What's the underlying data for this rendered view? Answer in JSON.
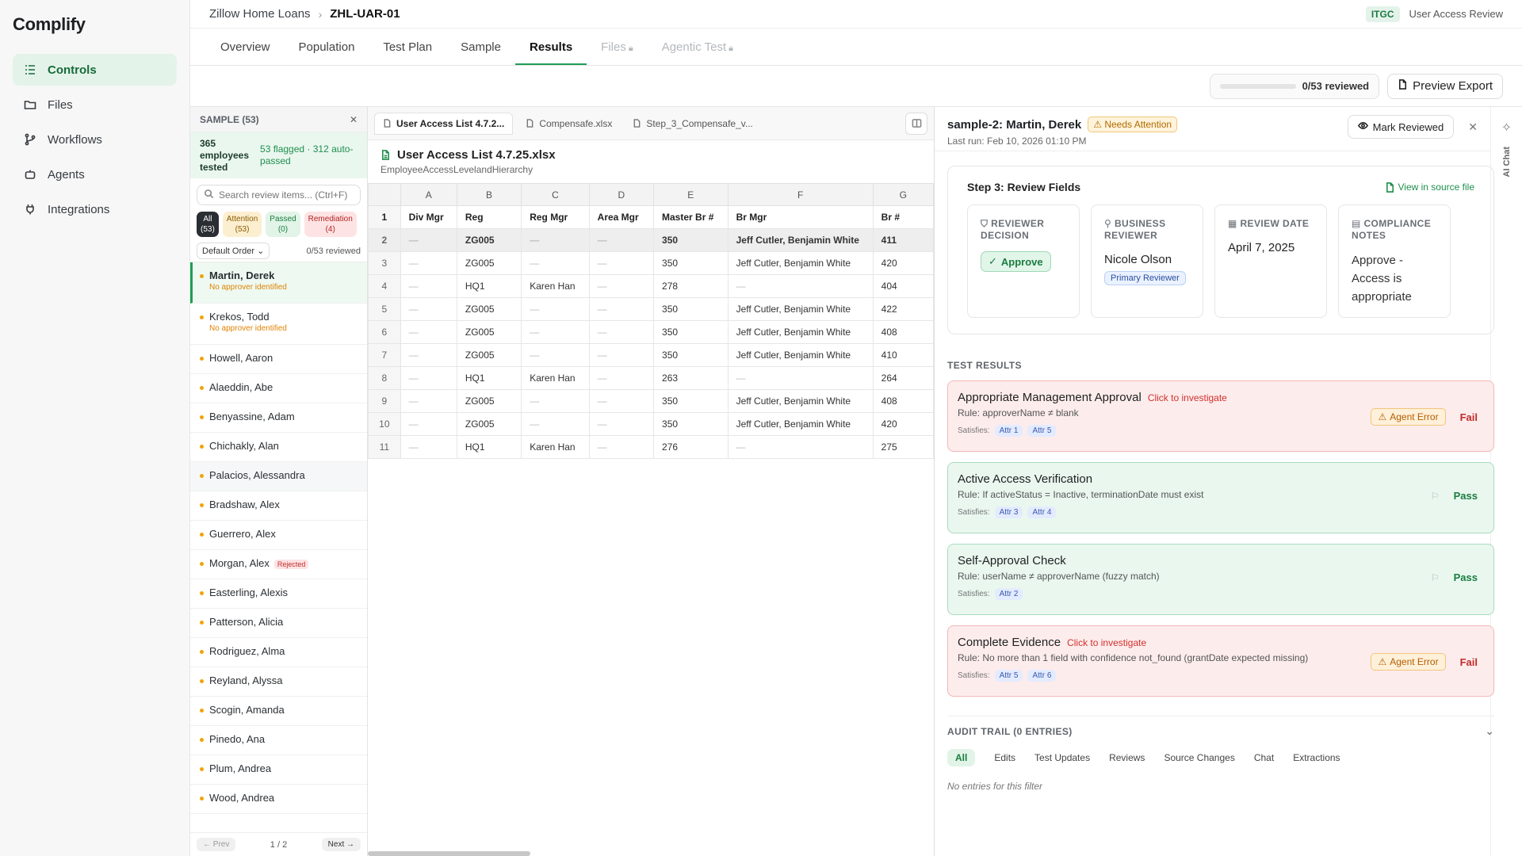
{
  "app": {
    "logo": "Complify"
  },
  "sidebar": {
    "items": [
      {
        "label": "Controls",
        "icon": "list-icon"
      },
      {
        "label": "Files",
        "icon": "folder-icon"
      },
      {
        "label": "Workflows",
        "icon": "branch-icon"
      },
      {
        "label": "Agents",
        "icon": "robot-icon"
      },
      {
        "label": "Integrations",
        "icon": "plug-icon"
      }
    ]
  },
  "breadcrumb": {
    "parent": "Zillow Home Loans",
    "current": "ZHL-UAR-01"
  },
  "header": {
    "badge": "ITGC",
    "title": "User Access Review"
  },
  "tabs": [
    {
      "label": "Overview"
    },
    {
      "label": "Population"
    },
    {
      "label": "Test Plan"
    },
    {
      "label": "Sample"
    },
    {
      "label": "Results"
    },
    {
      "label": "Files"
    },
    {
      "label": "Agentic Test"
    }
  ],
  "actions": {
    "reviewed": "0/53 reviewed",
    "progress": 0,
    "export": "Preview Export"
  },
  "samples": {
    "title": "SAMPLE (53)",
    "summary_left": "365 employees tested",
    "summary_right": "53 flagged · 312 auto-passed",
    "search_placeholder": "Search review items... (Ctrl+F)",
    "filters": [
      {
        "line1": "All",
        "line2": "(53)"
      },
      {
        "line1": "Attention",
        "line2": "(53)"
      },
      {
        "line1": "Passed",
        "line2": "(0)"
      },
      {
        "line1": "Remediation",
        "line2": "(4)"
      }
    ],
    "order": "Default Order",
    "reviewed": "0/53 reviewed",
    "items": [
      {
        "name": "Martin, Derek",
        "sub": "No approver identified",
        "tag": ""
      },
      {
        "name": "Krekos, Todd",
        "sub": "No approver identified",
        "tag": ""
      },
      {
        "name": "Howell, Aaron",
        "sub": "",
        "tag": ""
      },
      {
        "name": "Alaeddin, Abe",
        "sub": "",
        "tag": ""
      },
      {
        "name": "Benyassine, Adam",
        "sub": "",
        "tag": ""
      },
      {
        "name": "Chichakly, Alan",
        "sub": "",
        "tag": ""
      },
      {
        "name": "Palacios, Alessandra",
        "sub": "",
        "tag": ""
      },
      {
        "name": "Bradshaw, Alex",
        "sub": "",
        "tag": ""
      },
      {
        "name": "Guerrero, Alex",
        "sub": "",
        "tag": ""
      },
      {
        "name": "Morgan, Alex",
        "sub": "",
        "tag": "Rejected"
      },
      {
        "name": "Easterling, Alexis",
        "sub": "",
        "tag": ""
      },
      {
        "name": "Patterson, Alicia",
        "sub": "",
        "tag": ""
      },
      {
        "name": "Rodriguez, Alma",
        "sub": "",
        "tag": ""
      },
      {
        "name": "Reyland, Alyssa",
        "sub": "",
        "tag": ""
      },
      {
        "name": "Scogin, Amanda",
        "sub": "",
        "tag": ""
      },
      {
        "name": "Pinedo, Ana",
        "sub": "",
        "tag": ""
      },
      {
        "name": "Plum, Andrea",
        "sub": "",
        "tag": ""
      },
      {
        "name": "Wood, Andrea",
        "sub": "",
        "tag": ""
      }
    ],
    "prev": "← Prev",
    "page": "1 / 2",
    "next": "Next →"
  },
  "sheet": {
    "file_tabs": [
      {
        "label": "User Access List 4.7.2..."
      },
      {
        "label": "Compensafe.xlsx"
      },
      {
        "label": "Step_3_Compensafe_v..."
      }
    ],
    "file_title": "User Access List 4.7.25.xlsx",
    "file_sub": "EmployeeAccessLevelandHierarchy",
    "columns": [
      "A",
      "B",
      "C",
      "D",
      "E",
      "F",
      "G"
    ],
    "rows": [
      [
        "Div Mgr",
        "Reg",
        "Reg Mgr",
        "Area Mgr",
        "Master Br #",
        "Br Mgr",
        "Br #"
      ],
      [
        "—",
        "ZG005",
        "—",
        "—",
        "350",
        "Jeff Cutler, Benjamin White",
        "411"
      ],
      [
        "—",
        "ZG005",
        "—",
        "—",
        "350",
        "Jeff Cutler, Benjamin White",
        "420"
      ],
      [
        "—",
        "HQ1",
        "Karen Han",
        "—",
        "278",
        "—",
        "404"
      ],
      [
        "—",
        "ZG005",
        "—",
        "—",
        "350",
        "Jeff Cutler, Benjamin White",
        "422"
      ],
      [
        "—",
        "ZG005",
        "—",
        "—",
        "350",
        "Jeff Cutler, Benjamin White",
        "408"
      ],
      [
        "—",
        "ZG005",
        "—",
        "—",
        "350",
        "Jeff Cutler, Benjamin White",
        "410"
      ],
      [
        "—",
        "HQ1",
        "Karen Han",
        "—",
        "263",
        "—",
        "264"
      ],
      [
        "—",
        "ZG005",
        "—",
        "—",
        "350",
        "Jeff Cutler, Benjamin White",
        "408"
      ],
      [
        "—",
        "ZG005",
        "—",
        "—",
        "350",
        "Jeff Cutler, Benjamin White",
        "420"
      ],
      [
        "—",
        "HQ1",
        "Karen Han",
        "—",
        "276",
        "—",
        "275"
      ]
    ]
  },
  "detail": {
    "title": "sample-2: Martin, Derek",
    "status": "Needs Attention",
    "last_run": "Last run: Feb 10, 2026 01:10 PM",
    "mark": "Mark Reviewed",
    "step_title": "Step 3: Review Fields",
    "source_link": "View in source file",
    "fields": {
      "decision_label": "REVIEWER DECISION",
      "decision": "Approve",
      "business_label": "BUSINESS REVIEWER",
      "business": "Nicole Olson",
      "primary": "Primary Reviewer",
      "date_label": "REVIEW DATE",
      "date": "April 7, 2025",
      "notes_label": "COMPLIANCE NOTES",
      "notes": "Approve - Access is appropriate"
    },
    "test_results_label": "TEST RESULTS",
    "satisfies_label": "Satisfies:",
    "tests": [
      {
        "title": "Appropriate Management Approval",
        "investigate": "Click to investigate",
        "rule": "Rule: approverName ≠ blank",
        "attrs": [
          "Attr 1",
          "Attr 5"
        ],
        "badge": "Agent Error",
        "result": "Fail",
        "status": "fail"
      },
      {
        "title": "Active Access Verification",
        "investigate": "",
        "rule": "Rule: If activeStatus = Inactive, terminationDate must exist",
        "attrs": [
          "Attr 3",
          "Attr 4"
        ],
        "badge": "",
        "result": "Pass",
        "status": "pass"
      },
      {
        "title": "Self-Approval Check",
        "investigate": "",
        "rule": "Rule: userName ≠ approverName (fuzzy match)",
        "attrs": [
          "Attr 2"
        ],
        "badge": "",
        "result": "Pass",
        "status": "pass"
      },
      {
        "title": "Complete Evidence",
        "investigate": "Click to investigate",
        "rule": "Rule: No more than 1 field with confidence not_found (grantDate expected missing)",
        "attrs": [
          "Attr 5",
          "Attr 6"
        ],
        "badge": "Agent Error",
        "result": "Fail",
        "status": "fail"
      }
    ],
    "audit_label": "AUDIT TRAIL (0 ENTRIES)",
    "audit_tabs": [
      "All",
      "Edits",
      "Test Updates",
      "Reviews",
      "Source Changes",
      "Chat",
      "Extractions"
    ],
    "audit_empty": "No entries for this filter",
    "ai_chat": "AI Chat"
  },
  "colors": {
    "accent": "#1f9d55",
    "fail": "#c12b2b",
    "warning": "#b26b00"
  }
}
